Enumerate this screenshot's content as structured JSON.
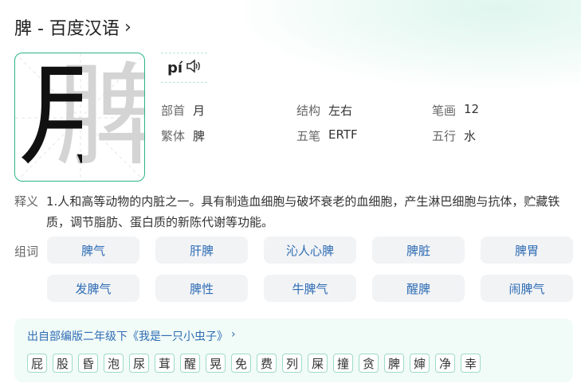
{
  "header": {
    "title": "脾 - 百度汉语",
    "chevron": "›"
  },
  "character": {
    "glyph": "脾",
    "left_component": "月"
  },
  "pinyin": {
    "text": "pí",
    "speaker_icon": "speaker-icon"
  },
  "info": [
    [
      {
        "k": "部首",
        "v": "月"
      },
      {
        "k": "结构",
        "v": "左右"
      },
      {
        "k": "笔画",
        "v": "12"
      }
    ],
    [
      {
        "k": "繁体",
        "v": "脾"
      },
      {
        "k": "五笔",
        "v": "ERTF"
      },
      {
        "k": "五行",
        "v": "水"
      }
    ]
  ],
  "definition": {
    "label": "释义",
    "text": "1.人和高等动物的内脏之一。具有制造血细胞与破坏衰老的血细胞，产生淋巴细胞与抗体，贮藏铁质，调节脂肪、蛋白质的新陈代谢等功能。"
  },
  "words": {
    "label": "组词",
    "items": [
      "脾气",
      "肝脾",
      "沁人心脾",
      "脾脏",
      "脾胃",
      "发脾气",
      "脾性",
      "牛脾气",
      "醒脾",
      "闹脾气"
    ]
  },
  "source": {
    "title": "出自部编版二年级下《我是一只小虫子》",
    "chevron": "›",
    "chars": [
      "屁",
      "股",
      "昏",
      "泡",
      "尿",
      "茸",
      "醒",
      "晃",
      "免",
      "费",
      "列",
      "屎",
      "撞",
      "贪",
      "脾",
      "婶",
      "净",
      "幸"
    ]
  },
  "colors": {
    "accent": "#2db38a",
    "link": "#2f6db5",
    "chip_border": "#9edcc6"
  }
}
